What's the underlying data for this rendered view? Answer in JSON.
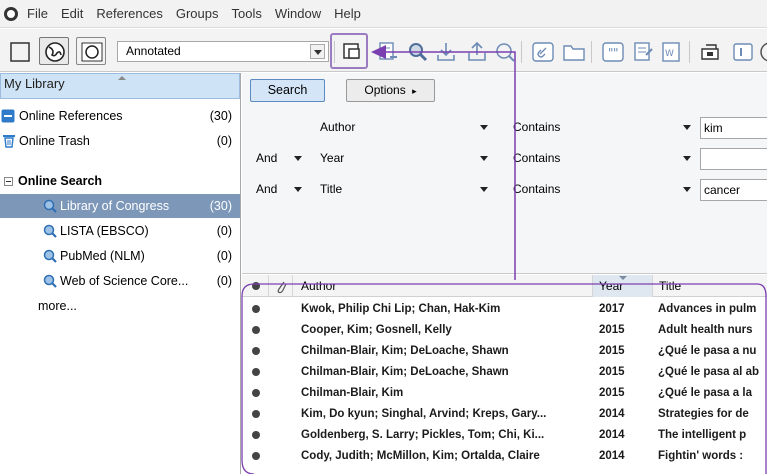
{
  "menu": {
    "items": [
      "File",
      "Edit",
      "References",
      "Groups",
      "Tools",
      "Window",
      "Help"
    ]
  },
  "toolbar": {
    "group_select_value": "Annotated",
    "icons": [
      "library-mode-icon",
      "online-search-mode-icon",
      "integrated-mode-icon",
      "copy-to-library-icon",
      "new-reference-icon",
      "online-search-icon",
      "import-icon",
      "export-icon",
      "find-full-text-icon",
      "open-link-icon",
      "open-file-icon",
      "insert-citation-icon",
      "format-bibliography-icon",
      "word-icon",
      "help-icon"
    ]
  },
  "sidebar": {
    "header": "My Library",
    "items": [
      {
        "label": "Online References",
        "count": "(30)"
      },
      {
        "label": "Online Trash",
        "count": "(0)"
      }
    ],
    "online_search_label": "Online Search",
    "search_items": [
      {
        "label": "Library of Congress",
        "count": "(30)"
      },
      {
        "label": "LISTA (EBSCO)",
        "count": "(0)"
      },
      {
        "label": "PubMed (NLM)",
        "count": "(0)"
      },
      {
        "label": "Web of Science Core...",
        "count": "(0)"
      }
    ],
    "more_label": "more..."
  },
  "search": {
    "search_button": "Search",
    "options_button": "Options",
    "options_arrow": "▸",
    "rows": [
      {
        "bool": "",
        "field": "Author",
        "op": "Contains",
        "value": "kim"
      },
      {
        "bool": "And",
        "field": "Year",
        "op": "Contains",
        "value": ""
      },
      {
        "bool": "And",
        "field": "Title",
        "op": "Contains",
        "value": "cancer"
      }
    ]
  },
  "results": {
    "columns": {
      "author": "Author",
      "year": "Year",
      "title": "Title"
    },
    "rows": [
      {
        "author": "Kwok, Philip Chi Lip; Chan, Hak-Kim",
        "year": "2017",
        "title": "Advances in pulm"
      },
      {
        "author": "Cooper, Kim; Gosnell, Kelly",
        "year": "2015",
        "title": "Adult health nurs"
      },
      {
        "author": "Chilman-Blair, Kim; DeLoache, Shawn",
        "year": "2015",
        "title": "¿Qué le pasa a nu"
      },
      {
        "author": "Chilman-Blair, Kim; DeLoache, Shawn",
        "year": "2015",
        "title": "¿Qué le pasa al ab"
      },
      {
        "author": "Chilman-Blair, Kim",
        "year": "2015",
        "title": "¿Qué le pasa a la"
      },
      {
        "author": "Kim, Do kyun; Singhal, Arvind; Kreps, Gary...",
        "year": "2014",
        "title": "Strategies for de"
      },
      {
        "author": "Goldenberg, S. Larry; Pickles, Tom; Chi, Ki...",
        "year": "2014",
        "title": "The intelligent p"
      },
      {
        "author": "Cody, Judith; McMillon, Kim; Ortalda, Claire",
        "year": "2014",
        "title": "Fightin' words :"
      }
    ]
  },
  "colors": {
    "annotation": "#7b3fb0",
    "selected_row": "#7d97b9",
    "library_header": "#cfe3f6"
  }
}
